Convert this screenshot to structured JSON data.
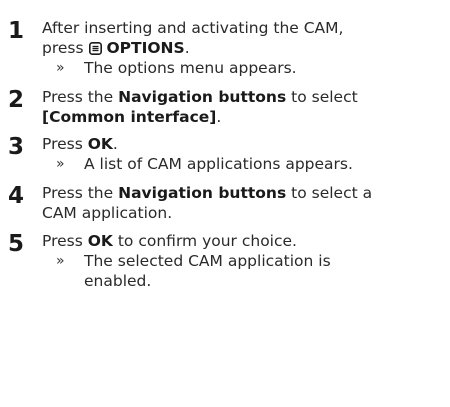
{
  "icons": {
    "options": "options-menu-icon"
  },
  "steps": [
    {
      "number": "1",
      "line1": "After inserting and activating the CAM,",
      "press": "press",
      "options_label": "OPTIONS",
      "period": ".",
      "result": "The options menu appears."
    },
    {
      "number": "2",
      "press": "Press the",
      "nav": "Navigation buttons",
      "to_select": "to select",
      "option": "[Common interface]",
      "period": "."
    },
    {
      "number": "3",
      "press": "Press",
      "ok": "OK",
      "period": ".",
      "result": "A list of CAM applications appears."
    },
    {
      "number": "4",
      "press": "Press the",
      "nav": "Navigation buttons",
      "to_select": "to select a",
      "line2": "CAM application."
    },
    {
      "number": "5",
      "press": "Press",
      "ok": "OK",
      "tail": "to confirm your choice.",
      "result_line1": "The selected CAM application is",
      "result_line2": "enabled."
    }
  ],
  "result_marker": "»"
}
